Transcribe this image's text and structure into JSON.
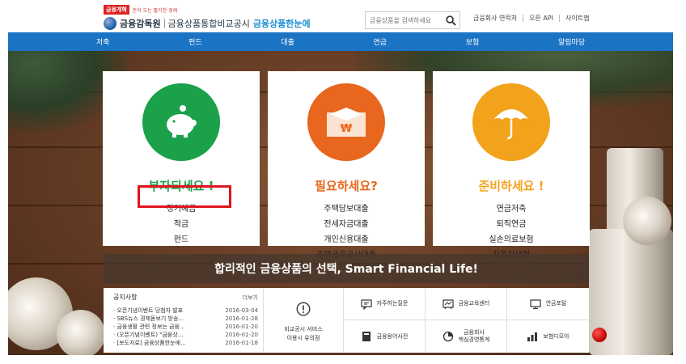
{
  "header": {
    "logo_badge": "금융개혁",
    "logo_slogan": "돈이 도는 활기찬 경제",
    "org": "금융감독원",
    "subtitle": "금융상품통합비교공시",
    "brand": "금융상품한눈에",
    "search_placeholder": "금융상품을 검색하세요",
    "links": [
      "금융회사 연락처",
      "오픈 API",
      "사이트맵"
    ]
  },
  "nav": [
    "저축",
    "펀드",
    "대출",
    "연금",
    "보험",
    "알림마당"
  ],
  "cards": [
    {
      "heading": "부자되세요 !",
      "color": "#1aa14a",
      "icon": "piggy-bank-icon",
      "items": [
        "정기예금",
        "적금",
        "펀드"
      ]
    },
    {
      "heading": "필요하세요?",
      "color": "#e8661d",
      "icon": "won-envelope-icon",
      "items": [
        "주택담보대출",
        "전세자금대출",
        "개인신용대출",
        "주택금융공사대출"
      ]
    },
    {
      "heading": "준비하세요 !",
      "color": "#f3a21b",
      "icon": "umbrella-icon",
      "items": [
        "연금저축",
        "퇴직연금",
        "실손의료보험",
        "자동차보험"
      ]
    }
  ],
  "banner": "합리적인 금융상품의 선택, Smart Financial Life!",
  "notice": {
    "title": "공지사항",
    "more": "더보기",
    "items": [
      {
        "title": "오픈기념이벤트 당첨자 발표",
        "date": "2016-03-04"
      },
      {
        "title": "SBS뉴스 경제돋보기 방송...",
        "date": "2016-01-28"
      },
      {
        "title": "금융생활 관련 정보는 금융...",
        "date": "2016-01-20"
      },
      {
        "title": "(오픈기념이벤트) \"금융상...",
        "date": "2016-01-20"
      },
      {
        "title": "[보도자료] 금융상품한눈에...",
        "date": "2016-01-18"
      }
    ]
  },
  "guide": {
    "icon": "exclamation-icon",
    "line1": "비교공시 서비스",
    "line2": "이용시 유의점"
  },
  "quick_links": [
    {
      "label": "자주하는질문",
      "icon": "chat-icon"
    },
    {
      "label": "금융교육센터",
      "icon": "board-icon"
    },
    {
      "label": "연금포털",
      "icon": "monitor-icon"
    },
    {
      "label": "금융용어사전",
      "icon": "book-icon"
    },
    {
      "label": "금융회사\n핵심경영통계",
      "icon": "pie-chart-icon"
    },
    {
      "label": "보험다모아",
      "icon": "coins-icon"
    }
  ]
}
